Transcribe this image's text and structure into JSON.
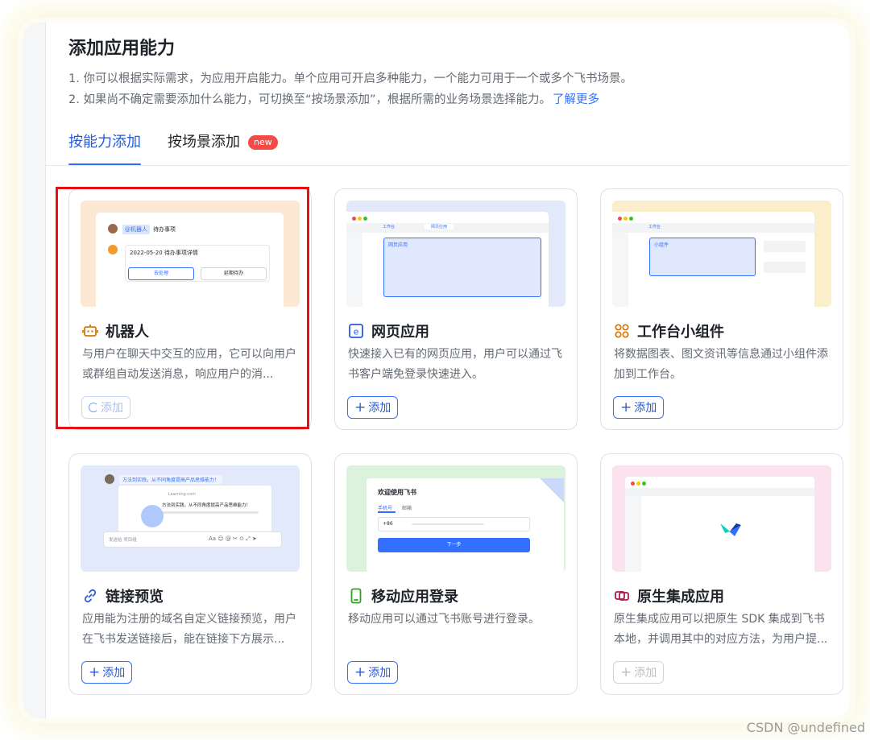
{
  "page": {
    "title": "添加应用能力",
    "desc_line1": "1. 你可以根据实际需求，为应用开启能力。单个应用可开启多种能力，一个能力可用于一个或多个飞书场景。",
    "desc_line2": "2. 如果尚不确定需要添加什么能力，可切换至“按场景添加”，根据所需的业务场景选择能力。",
    "learn_more": "了解更多"
  },
  "tabs": [
    {
      "label": "按能力添加",
      "active": true
    },
    {
      "label": "按场景添加",
      "badge": "new"
    }
  ],
  "cards": [
    {
      "name": "机器人",
      "icon": "robot-icon",
      "description": "与用户在聊天中交互的应用，它可以向用户或群组自动发送消息，响应用户的消...",
      "button": "添加",
      "button_state": "loading",
      "highlighted": true,
      "preview_bg": "#fde9d3",
      "preview": {
        "mention": "@机器人",
        "header": "待办事项",
        "date_line": "2022-05-20 待办事项详情",
        "btn1": "去处理",
        "btn2": "延期待办"
      }
    },
    {
      "name": "网页应用",
      "icon": "web-app-icon",
      "description": "快速接入已有的网页应用，用户可以通过飞书客户端免登录快速进入。",
      "button": "添加",
      "button_state": "enabled",
      "preview_bg": "#e1e9fb",
      "preview": {
        "tab1": "工作台",
        "tab2": "网页应用",
        "panel": "网页应用"
      }
    },
    {
      "name": "工作台小组件",
      "icon": "widget-icon",
      "description": "将数据图表、图文资讯等信息通过小组件添加到工作台。",
      "button": "添加",
      "button_state": "enabled",
      "preview_bg": "#fbeeca",
      "preview": {
        "tab1": "工作台",
        "panel": "小组件"
      }
    },
    {
      "name": "链接预览",
      "icon": "link-icon",
      "description": "应用能为注册的域名自定义链接预览，用户在飞书发送链接后，能在链接下方展示...",
      "button": "添加",
      "button_state": "enabled",
      "preview_bg": "#e1e9fb",
      "preview": {
        "link": "方法到实践，从不同角度提高产品思维能力！",
        "site": "Learning.com",
        "card_title": "方法到实践，从不同角度提高产品思维能力！",
        "input": "发送给 项目组"
      }
    },
    {
      "name": "移动应用登录",
      "icon": "mobile-icon",
      "description": "移动应用可以通过飞书账号进行登录。",
      "button": "添加",
      "button_state": "enabled",
      "preview_bg": "#dcf2dc",
      "preview": {
        "welcome": "欢迎使用飞书",
        "tab_phone": "手机号",
        "tab_email": "邮箱",
        "code": "+86",
        "next": "下一步"
      }
    },
    {
      "name": "原生集成应用",
      "icon": "native-app-icon",
      "description": "原生集成应用可以把原生 SDK 集成到飞书本地，并调用其中的对应方法，为用户提...",
      "button": "添加",
      "button_state": "disabled",
      "preview_bg": "#fce1ee",
      "preview": {}
    }
  ],
  "colors": {
    "accent": "#3370ff",
    "highlight": "#e80f13",
    "badge": "#f54a45"
  },
  "watermark": "CSDN @undefined"
}
